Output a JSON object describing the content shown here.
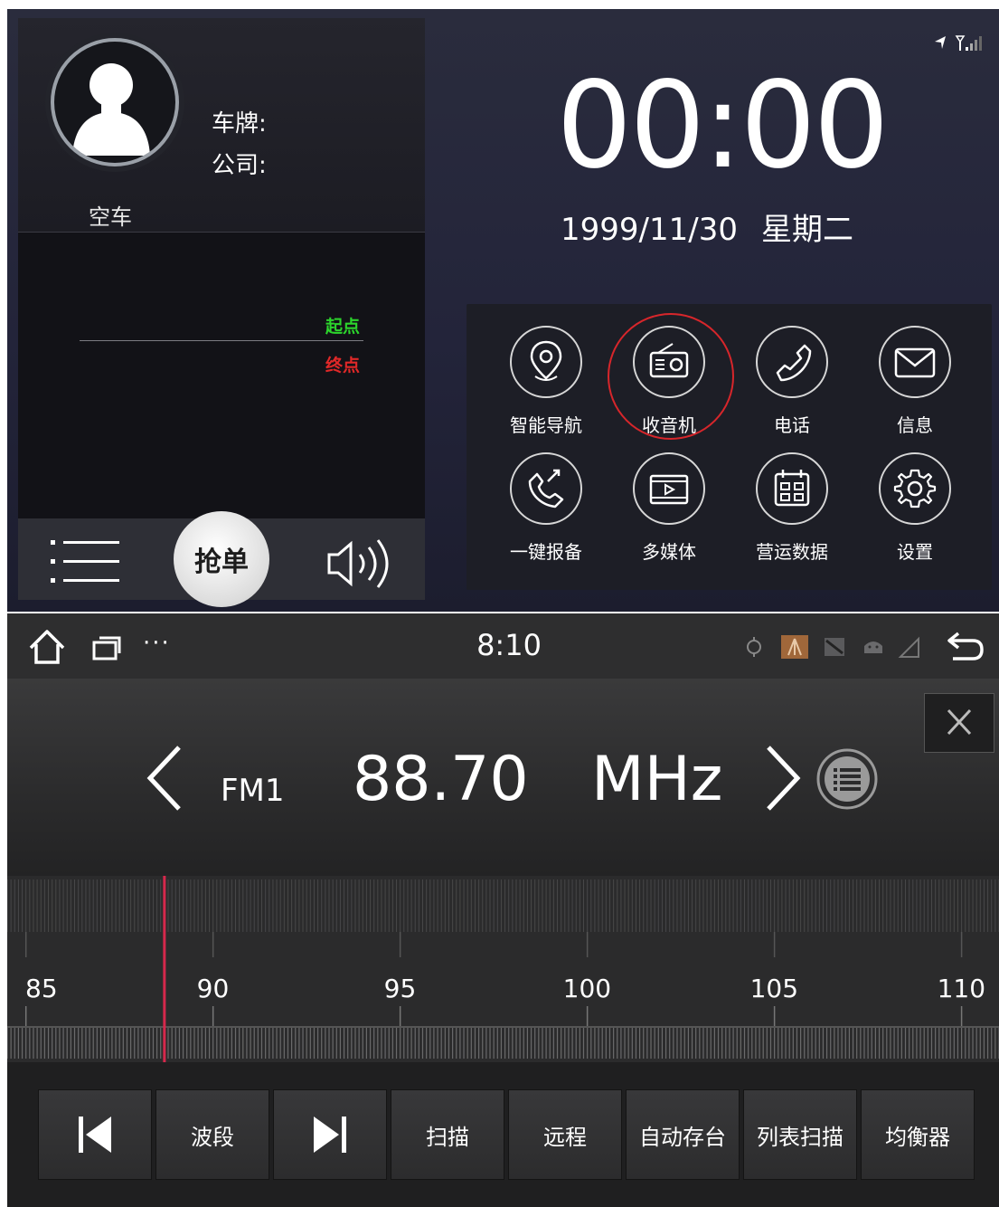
{
  "top": {
    "profile": {
      "plate_label": "车牌:",
      "company_label": "公司:",
      "status": "空车"
    },
    "route": {
      "start_label": "起点",
      "end_label": "终点"
    },
    "bottombar": {
      "grab_label": "抢单",
      "list_icon": "list-icon",
      "speaker_icon": "speaker-icon"
    },
    "clock": {
      "time": "00:00",
      "date": "1999/11/30",
      "weekday": "星期二"
    },
    "apps": [
      {
        "label": "智能导航",
        "icon": "location-pin-icon"
      },
      {
        "label": "收音机",
        "icon": "radio-icon",
        "highlighted": true
      },
      {
        "label": "电话",
        "icon": "phone-icon"
      },
      {
        "label": "信息",
        "icon": "envelope-icon"
      },
      {
        "label": "一键报备",
        "icon": "phone-report-icon"
      },
      {
        "label": "多媒体",
        "icon": "film-icon"
      },
      {
        "label": "营运数据",
        "icon": "calendar-data-icon"
      },
      {
        "label": "设置",
        "icon": "gear-icon"
      }
    ],
    "colors": {
      "route_start": "#2cd42c",
      "route_end": "#e02828",
      "highlight": "#d7262b"
    }
  },
  "bottom": {
    "statusbar": {
      "time": "8:10",
      "more": "···"
    },
    "tuner": {
      "band": "FM1",
      "frequency": "88.70",
      "unit": "MHz",
      "current_value": 88.7
    },
    "scale": {
      "min": 84.5,
      "max": 111,
      "labels": [
        "85",
        "90",
        "95",
        "100",
        "105",
        "110"
      ]
    },
    "controls": [
      {
        "label": "",
        "icon": "skip-previous-icon"
      },
      {
        "label": "波段"
      },
      {
        "label": "",
        "icon": "skip-next-icon"
      },
      {
        "label": "扫描"
      },
      {
        "label": "远程"
      },
      {
        "label": "自动存台"
      },
      {
        "label": "列表扫描"
      },
      {
        "label": "均衡器"
      }
    ],
    "colors": {
      "needle": "#d6284c"
    }
  }
}
